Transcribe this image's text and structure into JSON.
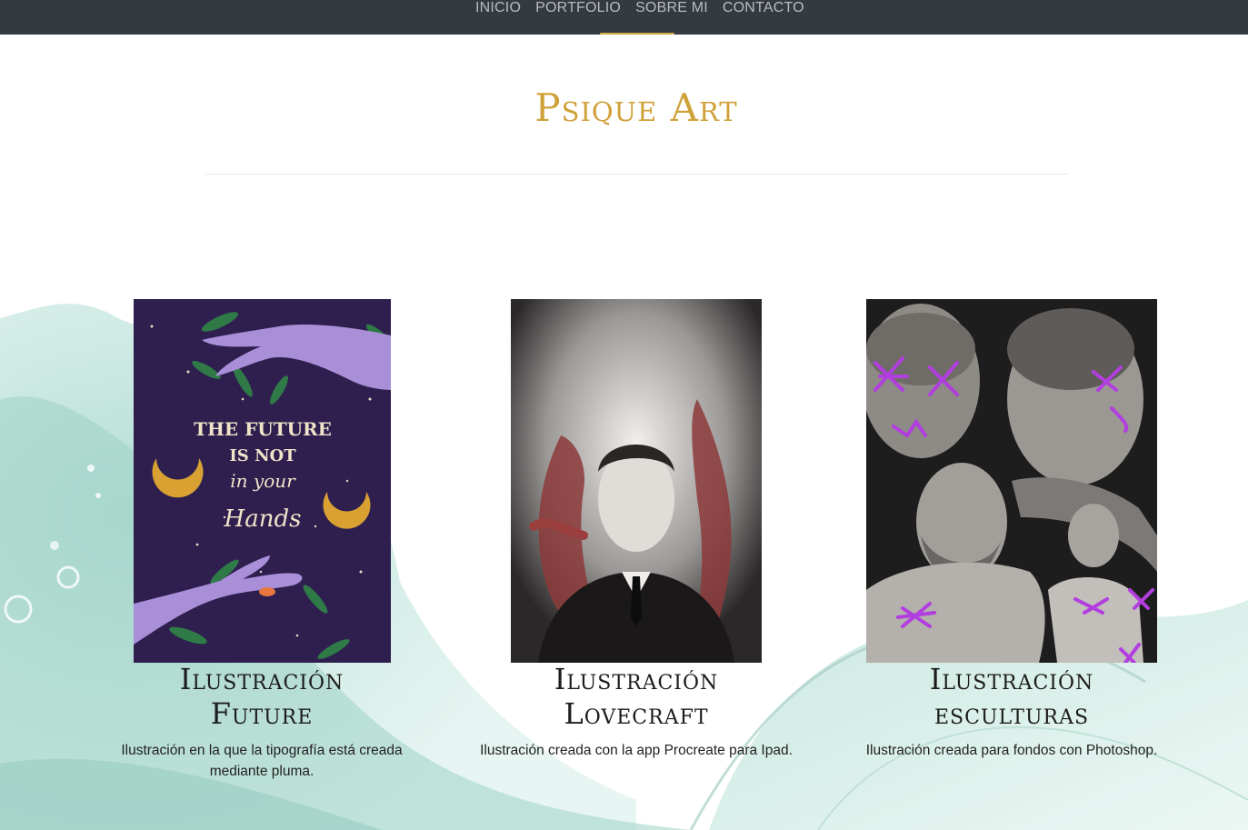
{
  "nav": {
    "items": [
      {
        "label": "INICIO"
      },
      {
        "label": "PORTFOLIO"
      },
      {
        "label": "SOBRE MI"
      },
      {
        "label": "CONTACTO"
      }
    ]
  },
  "header": {
    "title": "Psique Art"
  },
  "cards": [
    {
      "title_line1": "Ilustración",
      "title_line2": "Future",
      "description": "Ilustración en la que la tipografía está creada mediante pluma.",
      "art": {
        "line1": "THE FUTURE",
        "line2": "IS NOT",
        "line3": "in your",
        "line4": "Hands"
      }
    },
    {
      "title_line1": "Ilustración",
      "title_line2": "Lovecraft",
      "description": "Ilustración creada con la app Procreate para Ipad."
    },
    {
      "title_line1": "Ilustración",
      "title_line2": "esculturas",
      "description": "Ilustración creada para fondos con Photoshop."
    }
  ],
  "colors": {
    "navbar": "#343a40",
    "accent": "#cfa139",
    "wash": "#9fd3c7"
  }
}
